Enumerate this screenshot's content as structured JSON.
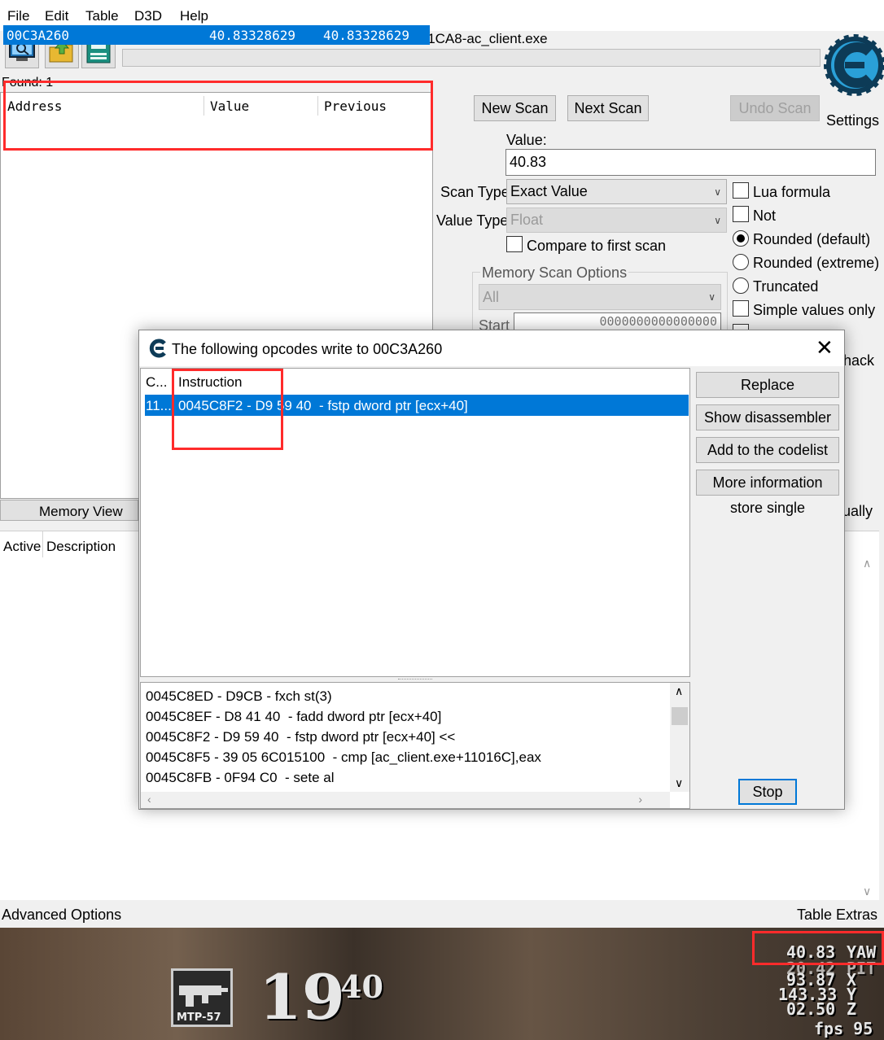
{
  "menu": [
    "File",
    "Edit",
    "Table",
    "D3D",
    "Help"
  ],
  "process_title": "00001CA8-ac_client.exe",
  "settings_label": "Settings",
  "found_label": "Found: 1",
  "results": {
    "columns": [
      "Address",
      "Value",
      "Previous"
    ],
    "rows": [
      {
        "address": "00C3A260",
        "value": "40.83328629",
        "previous": "40.83328629"
      }
    ]
  },
  "scan": {
    "new_scan": "New Scan",
    "next_scan": "Next Scan",
    "undo_scan": "Undo Scan",
    "value_label": "Value:",
    "value": "40.83",
    "scan_type_label": "Scan Type",
    "scan_type": "Exact Value",
    "value_type_label": "Value Type",
    "value_type": "Float",
    "compare_first": "Compare to first scan",
    "options": {
      "lua_formula": "Lua formula",
      "not": "Not",
      "rounded_default": "Rounded (default)",
      "rounded_extreme": "Rounded (extreme)",
      "truncated": "Truncated",
      "simple_values": "Simple values only"
    },
    "memory_group": "Memory Scan Options",
    "memory_region": "All",
    "start_label": "Start",
    "start_value": "0000000000000000",
    "partial_hack": "hack",
    "partial_ually": "ually"
  },
  "memory_view": "Memory View",
  "table": {
    "active": "Active",
    "description": "Description"
  },
  "advanced_options": "Advanced Options",
  "table_extras": "Table Extras",
  "dialog": {
    "title": "The following opcodes write to 00C3A260",
    "col_count": "C...",
    "col_instruction": "Instruction",
    "row_count": "11...",
    "row_instruction": "0045C8F2 - D9 59 40  - fstp dword ptr [ecx+40]",
    "buttons": {
      "replace": "Replace",
      "show_disassembler": "Show disassembler",
      "add_codelist": "Add to the codelist",
      "more_info": "More information",
      "stop": "Stop"
    },
    "info_text": "store single",
    "disassembly": [
      "0045C8ED - D9CB - fxch st(3)",
      "0045C8EF - D8 41 40  - fadd dword ptr [ecx+40]",
      "0045C8F2 - D9 59 40  - fstp dword ptr [ecx+40] <<",
      "0045C8F5 - 39 05 6C015100  - cmp [ac_client.exe+11016C],eax",
      "0045C8FB - 0F94 C0  - sete al"
    ]
  },
  "game_hud": {
    "weapon": "MTP-57",
    "ammo": "19",
    "mag": "40",
    "yaw_value": "40.83",
    "yaw_label": "YAW",
    "pitch_value": "20.42",
    "pitch_label": "PIT",
    "x_value": "93.87",
    "x_label": "X",
    "y_value": "143.33",
    "y_label": "Y",
    "z_value": "02.50",
    "z_label": "Z",
    "fps": "fps 95"
  }
}
